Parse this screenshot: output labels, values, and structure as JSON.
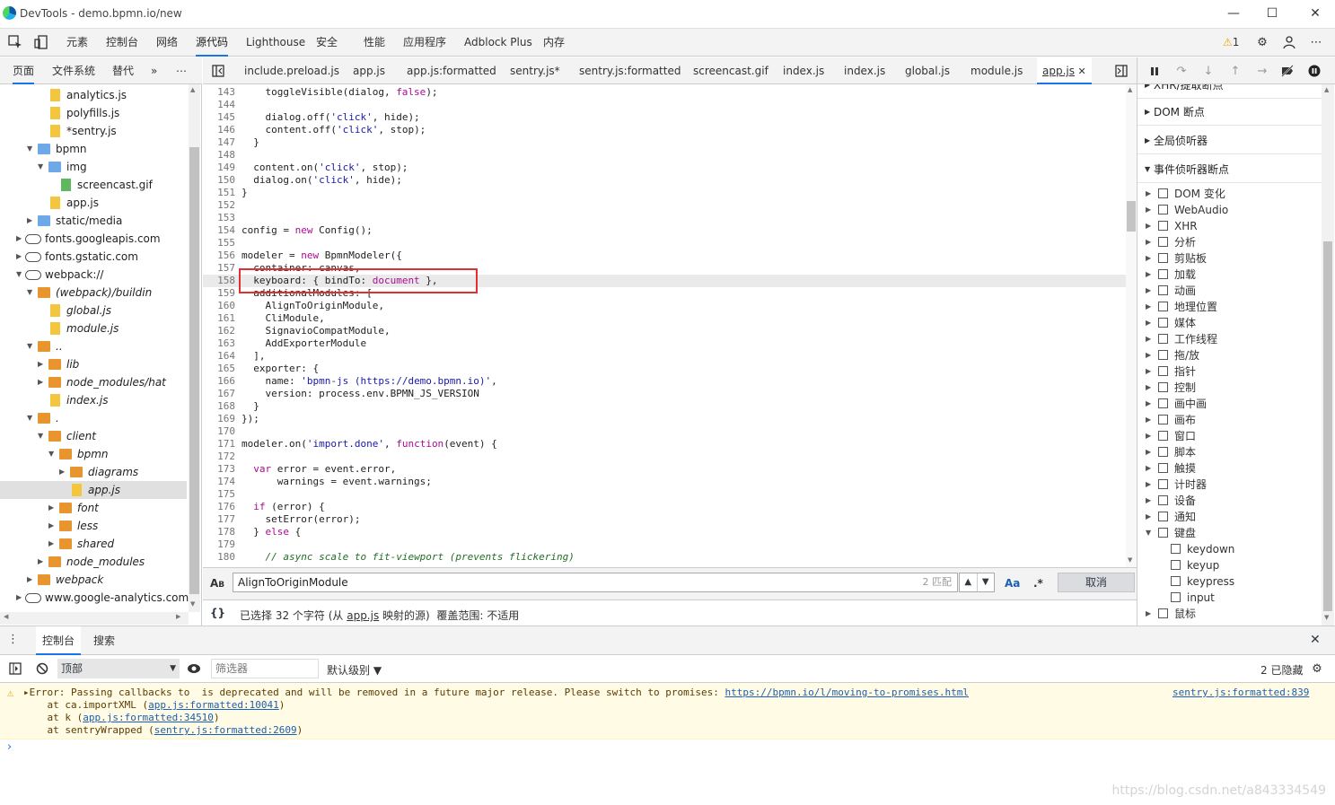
{
  "window": {
    "title": "DevTools - demo.bpmn.io/new"
  },
  "main_tabs": [
    "元素",
    "控制台",
    "网络",
    "源代码",
    "Lighthouse",
    "安全",
    "性能",
    "应用程序",
    "Adblock Plus",
    "内存"
  ],
  "warning_count": "1",
  "left_tabs": [
    "页面",
    "文件系统",
    "替代",
    "»"
  ],
  "tree": [
    {
      "label": "analytics.js",
      "icon": "file-yellow",
      "indent": 74,
      "italic": false
    },
    {
      "label": "polyfills.js",
      "icon": "file-yellow",
      "indent": 74,
      "italic": false
    },
    {
      "label": "*sentry.js",
      "icon": "file-yellow",
      "indent": 74,
      "italic": false
    },
    {
      "label": "bpmn",
      "icon": "folder-blue",
      "indent": 62,
      "italic": false,
      "arrow": "down"
    },
    {
      "label": "img",
      "icon": "folder-blue",
      "indent": 74,
      "italic": false,
      "arrow": "down"
    },
    {
      "label": "screencast.gif",
      "icon": "file-green",
      "indent": 86,
      "italic": false
    },
    {
      "label": "app.js",
      "icon": "file-yellow",
      "indent": 74,
      "italic": false
    },
    {
      "label": "static/media",
      "icon": "folder-blue",
      "indent": 62,
      "italic": false,
      "arrow": "right"
    },
    {
      "label": "fonts.googleapis.com",
      "icon": "cloud",
      "indent": 50,
      "italic": false,
      "arrow": "right"
    },
    {
      "label": "fonts.gstatic.com",
      "icon": "cloud",
      "indent": 50,
      "italic": false,
      "arrow": "right"
    },
    {
      "label": "webpack://",
      "icon": "cloud",
      "indent": 50,
      "italic": false,
      "arrow": "down"
    },
    {
      "label": "(webpack)/buildin",
      "icon": "folder-orange",
      "indent": 62,
      "italic": true,
      "arrow": "down"
    },
    {
      "label": "global.js",
      "icon": "file-yellow",
      "indent": 74,
      "italic": true
    },
    {
      "label": "module.js",
      "icon": "file-yellow",
      "indent": 74,
      "italic": true
    },
    {
      "label": "..",
      "icon": "folder-orange",
      "indent": 62,
      "italic": true,
      "arrow": "down"
    },
    {
      "label": "lib",
      "icon": "folder-orange",
      "indent": 74,
      "italic": true,
      "arrow": "right"
    },
    {
      "label": "node_modules/hat",
      "icon": "folder-orange",
      "indent": 74,
      "italic": true,
      "arrow": "right"
    },
    {
      "label": "index.js",
      "icon": "file-yellow",
      "indent": 74,
      "italic": true
    },
    {
      "label": ".",
      "icon": "folder-orange",
      "indent": 62,
      "italic": true,
      "arrow": "down"
    },
    {
      "label": "client",
      "icon": "folder-orange",
      "indent": 74,
      "italic": true,
      "arrow": "down"
    },
    {
      "label": "bpmn",
      "icon": "folder-orange",
      "indent": 86,
      "italic": true,
      "arrow": "down"
    },
    {
      "label": "diagrams",
      "icon": "folder-orange",
      "indent": 98,
      "italic": true,
      "arrow": "right"
    },
    {
      "label": "app.js",
      "icon": "file-yellow",
      "indent": 98,
      "italic": true,
      "selected": true
    },
    {
      "label": "font",
      "icon": "folder-orange",
      "indent": 86,
      "italic": true,
      "arrow": "right"
    },
    {
      "label": "less",
      "icon": "folder-orange",
      "indent": 86,
      "italic": true,
      "arrow": "right"
    },
    {
      "label": "shared",
      "icon": "folder-orange",
      "indent": 86,
      "italic": true,
      "arrow": "right"
    },
    {
      "label": "node_modules",
      "icon": "folder-orange",
      "indent": 74,
      "italic": true,
      "arrow": "right"
    },
    {
      "label": "webpack",
      "icon": "folder-orange",
      "indent": 62,
      "italic": true,
      "arrow": "right"
    },
    {
      "label": "www.google-analytics.com",
      "icon": "cloud",
      "indent": 50,
      "italic": false,
      "arrow": "right"
    }
  ],
  "file_tabs": [
    "include.preload.js",
    "app.js",
    "app.js:formatted",
    "sentry.js*",
    "sentry.js:formatted",
    "screencast.gif",
    "index.js",
    "index.js",
    "global.js",
    "module.js",
    "app.js"
  ],
  "code_lines": [
    {
      "n": "143",
      "segs": [
        [
          "    toggleVisible(dialog, ",
          ""
        ],
        [
          "false",
          "kw"
        ],
        [
          ");",
          ""
        ]
      ]
    },
    {
      "n": "144",
      "segs": []
    },
    {
      "n": "145",
      "segs": [
        [
          "    dialog.off(",
          ""
        ],
        [
          "'click'",
          "st"
        ],
        [
          ", hide);",
          ""
        ]
      ]
    },
    {
      "n": "146",
      "segs": [
        [
          "    content.off(",
          ""
        ],
        [
          "'click'",
          "st"
        ],
        [
          ", stop);",
          ""
        ]
      ]
    },
    {
      "n": "147",
      "segs": [
        [
          "  }",
          ""
        ]
      ]
    },
    {
      "n": "148",
      "segs": []
    },
    {
      "n": "149",
      "segs": [
        [
          "  content.on(",
          ""
        ],
        [
          "'click'",
          "st"
        ],
        [
          ", stop);",
          ""
        ]
      ]
    },
    {
      "n": "150",
      "segs": [
        [
          "  dialog.on(",
          ""
        ],
        [
          "'click'",
          "st"
        ],
        [
          ", hide);",
          ""
        ]
      ]
    },
    {
      "n": "151",
      "segs": [
        [
          "}",
          ""
        ]
      ]
    },
    {
      "n": "152",
      "segs": []
    },
    {
      "n": "153",
      "segs": []
    },
    {
      "n": "154",
      "segs": [
        [
          "config = ",
          ""
        ],
        [
          "new",
          "kw"
        ],
        [
          " Config();",
          ""
        ]
      ]
    },
    {
      "n": "155",
      "segs": []
    },
    {
      "n": "156",
      "segs": [
        [
          "modeler = ",
          ""
        ],
        [
          "new",
          "kw"
        ],
        [
          " BpmnModeler({",
          ""
        ]
      ]
    },
    {
      "n": "157",
      "segs": [
        [
          "  container: canvas,",
          ""
        ]
      ]
    },
    {
      "n": "158",
      "segs": [
        [
          "  keyboard: { bindTo: ",
          ""
        ],
        [
          "document",
          "kw"
        ],
        [
          " },",
          ""
        ]
      ]
    },
    {
      "n": "159",
      "segs": [
        [
          "  additionalModules: [",
          ""
        ]
      ]
    },
    {
      "n": "160",
      "segs": [
        [
          "    AlignToOriginModule,",
          ""
        ]
      ]
    },
    {
      "n": "161",
      "segs": [
        [
          "    CliModule,",
          ""
        ]
      ]
    },
    {
      "n": "162",
      "segs": [
        [
          "    SignavioCompatModule,",
          ""
        ]
      ]
    },
    {
      "n": "163",
      "segs": [
        [
          "    AddExporterModule",
          ""
        ]
      ]
    },
    {
      "n": "164",
      "segs": [
        [
          "  ],",
          ""
        ]
      ]
    },
    {
      "n": "165",
      "segs": [
        [
          "  exporter: {",
          ""
        ]
      ]
    },
    {
      "n": "166",
      "segs": [
        [
          "    name: ",
          ""
        ],
        [
          "'bpmn-js (https://demo.bpmn.io)'",
          "st"
        ],
        [
          ",",
          ""
        ]
      ]
    },
    {
      "n": "167",
      "segs": [
        [
          "    version: process.env.BPMN_JS_VERSION",
          ""
        ]
      ]
    },
    {
      "n": "168",
      "segs": [
        [
          "  }",
          ""
        ]
      ]
    },
    {
      "n": "169",
      "segs": [
        [
          "});",
          ""
        ]
      ]
    },
    {
      "n": "170",
      "segs": []
    },
    {
      "n": "171",
      "segs": [
        [
          "modeler.on(",
          ""
        ],
        [
          "'import.done'",
          "st"
        ],
        [
          ", ",
          ""
        ],
        [
          "function",
          "kw"
        ],
        [
          "(event) {",
          ""
        ]
      ]
    },
    {
      "n": "172",
      "segs": []
    },
    {
      "n": "173",
      "segs": [
        [
          "  ",
          ""
        ],
        [
          "var",
          "kw"
        ],
        [
          " error = event.error,",
          ""
        ]
      ]
    },
    {
      "n": "174",
      "segs": [
        [
          "      warnings = event.warnings;",
          ""
        ]
      ]
    },
    {
      "n": "175",
      "segs": []
    },
    {
      "n": "176",
      "segs": [
        [
          "  ",
          ""
        ],
        [
          "if",
          "kw"
        ],
        [
          " (error) {",
          ""
        ]
      ]
    },
    {
      "n": "177",
      "segs": [
        [
          "    setError(error);",
          ""
        ]
      ]
    },
    {
      "n": "178",
      "segs": [
        [
          "  } ",
          ""
        ],
        [
          "else",
          "kw"
        ],
        [
          " {",
          ""
        ]
      ]
    },
    {
      "n": "179",
      "segs": []
    },
    {
      "n": "180",
      "segs": [
        [
          "    ",
          ""
        ],
        [
          "// async scale to fit-viewport (prevents flickering)",
          "cm"
        ]
      ]
    }
  ],
  "search": {
    "value": "AlignToOriginModule",
    "match_count": "2 匹配",
    "case_label": "Aa",
    "regex_label": ".*",
    "cancel_label": "取消"
  },
  "status": {
    "braces": "{}",
    "text_pre": "已选择 32 个字符 (从 ",
    "link": "app.js",
    "text_post": " 映射的源)  覆盖范围: 不适用"
  },
  "right_sections": [
    "XHR/提取断点",
    "DOM 断点",
    "全局侦听器",
    "事件侦听器断点"
  ],
  "events": [
    {
      "label": "DOM 变化",
      "sub": false
    },
    {
      "label": "WebAudio",
      "sub": false
    },
    {
      "label": "XHR",
      "sub": false
    },
    {
      "label": "分析",
      "sub": false
    },
    {
      "label": "剪贴板",
      "sub": false
    },
    {
      "label": "加载",
      "sub": false
    },
    {
      "label": "动画",
      "sub": false
    },
    {
      "label": "地理位置",
      "sub": false
    },
    {
      "label": "媒体",
      "sub": false
    },
    {
      "label": "工作线程",
      "sub": false
    },
    {
      "label": "拖/放",
      "sub": false
    },
    {
      "label": "指针",
      "sub": false
    },
    {
      "label": "控制",
      "sub": false
    },
    {
      "label": "画中画",
      "sub": false
    },
    {
      "label": "画布",
      "sub": false
    },
    {
      "label": "窗口",
      "sub": false
    },
    {
      "label": "脚本",
      "sub": false
    },
    {
      "label": "触摸",
      "sub": false
    },
    {
      "label": "计时器",
      "sub": false
    },
    {
      "label": "设备",
      "sub": false
    },
    {
      "label": "通知",
      "sub": false
    },
    {
      "label": "键盘",
      "sub": false,
      "open": true
    },
    {
      "label": "keydown",
      "sub": true
    },
    {
      "label": "keyup",
      "sub": true
    },
    {
      "label": "keypress",
      "sub": true
    },
    {
      "label": "input",
      "sub": true
    },
    {
      "label": "鼠标",
      "sub": false
    }
  ],
  "drawer": {
    "tabs": [
      "控制台",
      "搜索"
    ],
    "context": "顶部",
    "filter_placeholder": "筛选器",
    "level": "默认级别 ▼",
    "hidden_count": "2 已隐藏",
    "warning": {
      "line1_pre": "▸Error: Passing callbacks to  is deprecated and will be removed in a future major release. Please switch to promises: ",
      "line1_link": "https://bpmn.io/l/moving-to-promises.html",
      "source": "sentry.js:formatted:839",
      "stack": [
        {
          "pre": "    at ca.importXML (",
          "link": "app.js:formatted:10041",
          "post": ")"
        },
        {
          "pre": "    at k (",
          "link": "app.js:formatted:34510",
          "post": ")"
        },
        {
          "pre": "    at sentryWrapped (",
          "link": "sentry.js:formatted:2609",
          "post": ")"
        }
      ]
    },
    "prompt": "›"
  },
  "watermark": "https://blog.csdn.net/a843334549"
}
